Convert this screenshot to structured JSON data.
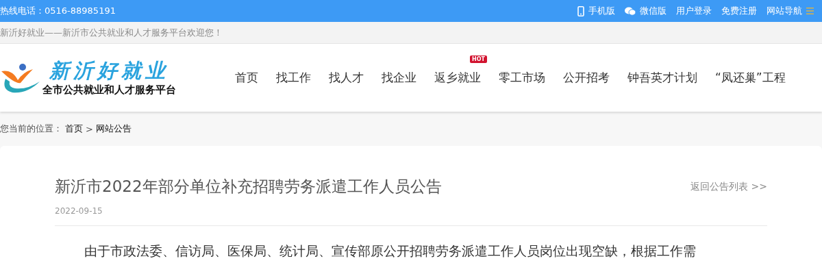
{
  "top_bar": {
    "hotline": "热线电话：0516-88985191",
    "links": [
      {
        "kind": "mobile",
        "label": "手机版"
      },
      {
        "kind": "wechat",
        "label": "微信版"
      },
      {
        "kind": "plain",
        "label": "用户登录"
      },
      {
        "kind": "plain",
        "label": "免费注册"
      },
      {
        "kind": "menu",
        "label": "网站导航"
      }
    ]
  },
  "welcome": "新沂好就业——新沂市公共就业和人才服务平台欢迎您！",
  "logo": {
    "name": "新沂好就业",
    "slogan": "全市公共就业和人才服务平台"
  },
  "nav": [
    {
      "label": "首页"
    },
    {
      "label": "找工作"
    },
    {
      "label": "找人才"
    },
    {
      "label": "找企业"
    },
    {
      "label": "返乡就业",
      "badge": "HOT"
    },
    {
      "label": "零工市场"
    },
    {
      "label": "公开招考"
    },
    {
      "label": "钟吾英才计划"
    },
    {
      "label": "“凤还巢”工程"
    }
  ],
  "breadcrumb": {
    "prefix": "您当前的位置：",
    "items": [
      "首页",
      "网站公告"
    ],
    "separator": ">"
  },
  "article": {
    "title": "新沂市2022年部分单位补充招聘劳务派遣工作人员公告",
    "back_link": "返回公告列表 >>",
    "date": "2022-09-15",
    "paragraph": "由于市政法委、信访局、医保局、统计局、宣传部原公开招聘劳务派遣工作人员岗位出现空缺，根据工作需"
  }
}
